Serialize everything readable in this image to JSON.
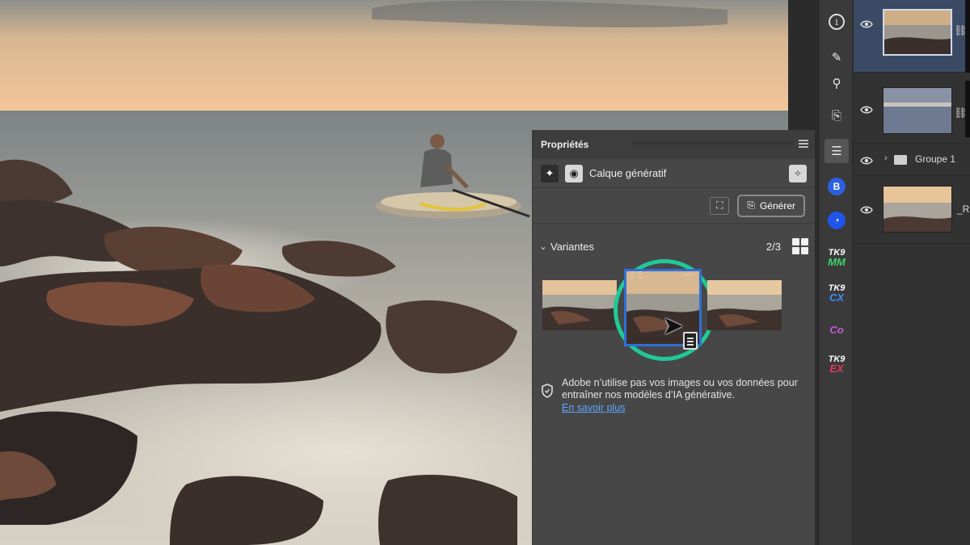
{
  "properties_panel": {
    "tab_title": "Propriétés",
    "layer_type": "Calque génératif",
    "generate_label": "Générer"
  },
  "variants": {
    "title": "Variantes",
    "count": "2/3",
    "selected_index": 2
  },
  "notice": {
    "text": "Adobe n’utilise pas vos images ou vos données pour entraîner nos modèles d’IA générative.",
    "link": "En savoir plus"
  },
  "tools": {
    "info_icon": "i",
    "plugin_b": "B",
    "tk_mm": "TK9 MM",
    "tk_cx": "TK9 CX",
    "tk_co": "Co",
    "tk_ex": "TK9 EX"
  },
  "tk_parts": {
    "mm_top": "TK9",
    "mm_bottom": "MM",
    "cx_top": "TK9",
    "cx_bottom": "CX",
    "co_bottom": "Co",
    "ex_top": "TK9",
    "ex_bottom": "EX"
  },
  "layers": {
    "group_label": "Groupe 1",
    "r_label": "_R"
  },
  "colors": {
    "selection_ring": "#20c997",
    "selection_frame": "#2f6fd6",
    "link": "#5ea6ff",
    "panel_bg": "#474747"
  }
}
